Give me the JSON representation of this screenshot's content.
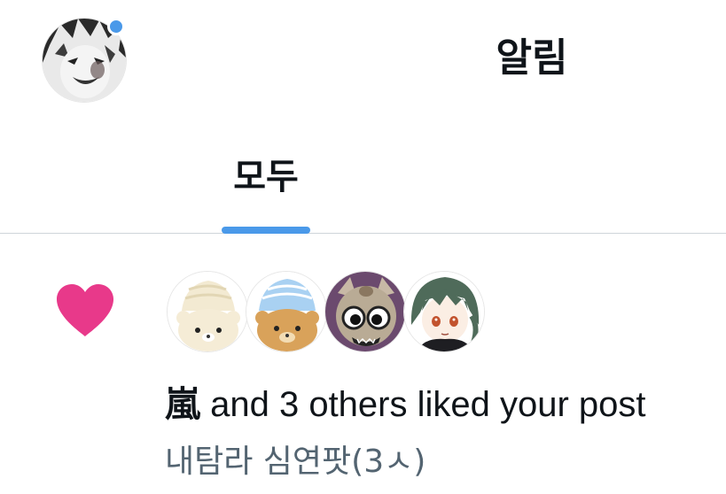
{
  "header": {
    "title": "알림",
    "profile_icon": "user-avatar-icon",
    "notification_dot_color": "#4a99e9"
  },
  "tabs": {
    "items": [
      {
        "label": "모두",
        "selected": true
      }
    ],
    "indicator_color": "#4a99e9"
  },
  "notification": {
    "type_icon": "heart-icon",
    "icon_color": "#e8398a",
    "avatars": [
      "bear-cream-avatar",
      "bear-blue-cream-avatar",
      "dog-cartoon-avatar",
      "green-hair-character-avatar"
    ],
    "actor_name": "嵐",
    "action_text": " and 3 others liked your post",
    "post_preview": "내탐라 심연팟(3ㅅ)"
  }
}
